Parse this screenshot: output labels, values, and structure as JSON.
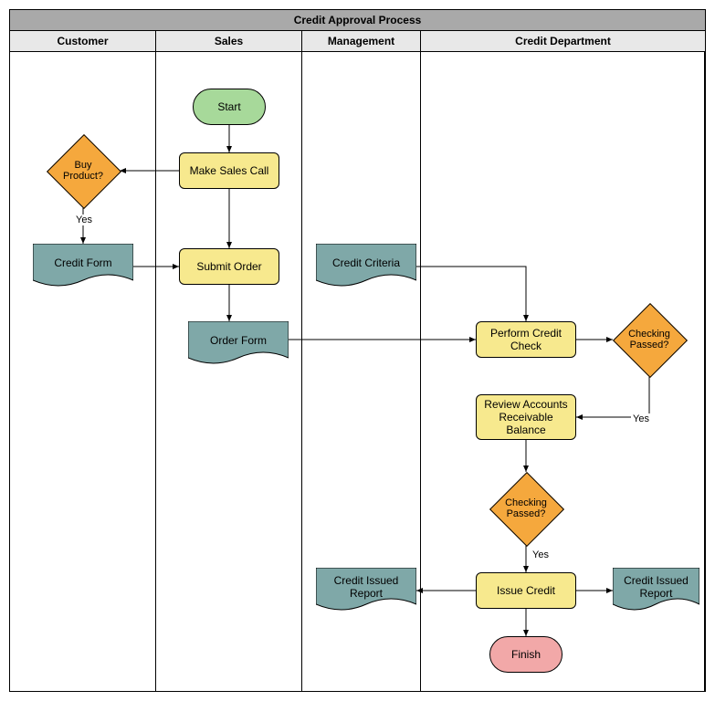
{
  "title": "Credit Approval Process",
  "lanes": {
    "customer": "Customer",
    "sales": "Sales",
    "management": "Management",
    "credit": "Credit Department"
  },
  "nodes": {
    "start": "Start",
    "make_sales_call": "Make Sales Call",
    "buy_product": "Buy Product?",
    "credit_form": "Credit Form",
    "submit_order": "Submit Order",
    "order_form": "Order Form",
    "credit_criteria": "Credit Criteria",
    "perform_credit_check": "Perform Credit Check",
    "checking_passed_1": "Checking Passed?",
    "review_accounts": "Review Accounts Receivable Balance",
    "checking_passed_2": "Checking Passed?",
    "issue_credit": "Issue Credit",
    "credit_issued_report_mgmt": "Credit Issued Report",
    "credit_issued_report_cd": "Credit Issued Report",
    "finish": "Finish"
  },
  "edge_labels": {
    "yes1": "Yes",
    "yes2": "Yes",
    "yes3": "Yes"
  },
  "chart_data": {
    "type": "swimlane-flowchart",
    "title": "Credit Approval Process",
    "lanes": [
      "Customer",
      "Sales",
      "Management",
      "Credit Department"
    ],
    "nodes": [
      {
        "id": "start",
        "lane": "Sales",
        "type": "terminator",
        "label": "Start"
      },
      {
        "id": "make_sales_call",
        "lane": "Sales",
        "type": "process",
        "label": "Make Sales Call"
      },
      {
        "id": "buy_product",
        "lane": "Customer",
        "type": "decision",
        "label": "Buy Product?"
      },
      {
        "id": "credit_form",
        "lane": "Customer",
        "type": "document",
        "label": "Credit Form"
      },
      {
        "id": "submit_order",
        "lane": "Sales",
        "type": "process",
        "label": "Submit Order"
      },
      {
        "id": "order_form",
        "lane": "Sales",
        "type": "document",
        "label": "Order Form"
      },
      {
        "id": "credit_criteria",
        "lane": "Management",
        "type": "document",
        "label": "Credit Criteria"
      },
      {
        "id": "perform_credit_check",
        "lane": "Credit Department",
        "type": "process",
        "label": "Perform Credit Check"
      },
      {
        "id": "checking_passed_1",
        "lane": "Credit Department",
        "type": "decision",
        "label": "Checking Passed?"
      },
      {
        "id": "review_accounts",
        "lane": "Credit Department",
        "type": "process",
        "label": "Review Accounts Receivable Balance"
      },
      {
        "id": "checking_passed_2",
        "lane": "Credit Department",
        "type": "decision",
        "label": "Checking Passed?"
      },
      {
        "id": "issue_credit",
        "lane": "Credit Department",
        "type": "process",
        "label": "Issue Credit"
      },
      {
        "id": "credit_issued_report_mgmt",
        "lane": "Management",
        "type": "document",
        "label": "Credit Issued Report"
      },
      {
        "id": "credit_issued_report_cd",
        "lane": "Credit Department",
        "type": "document",
        "label": "Credit Issued Report"
      },
      {
        "id": "finish",
        "lane": "Credit Department",
        "type": "terminator",
        "label": "Finish"
      }
    ],
    "edges": [
      {
        "from": "start",
        "to": "make_sales_call"
      },
      {
        "from": "make_sales_call",
        "to": "buy_product"
      },
      {
        "from": "buy_product",
        "to": "credit_form",
        "label": "Yes"
      },
      {
        "from": "credit_form",
        "to": "submit_order"
      },
      {
        "from": "make_sales_call",
        "to": "submit_order"
      },
      {
        "from": "submit_order",
        "to": "order_form"
      },
      {
        "from": "order_form",
        "to": "perform_credit_check"
      },
      {
        "from": "credit_criteria",
        "to": "perform_credit_check"
      },
      {
        "from": "perform_credit_check",
        "to": "checking_passed_1"
      },
      {
        "from": "checking_passed_1",
        "to": "review_accounts",
        "label": "Yes"
      },
      {
        "from": "review_accounts",
        "to": "checking_passed_2"
      },
      {
        "from": "checking_passed_2",
        "to": "issue_credit",
        "label": "Yes"
      },
      {
        "from": "issue_credit",
        "to": "credit_issued_report_mgmt"
      },
      {
        "from": "issue_credit",
        "to": "credit_issued_report_cd"
      },
      {
        "from": "issue_credit",
        "to": "finish"
      }
    ]
  }
}
